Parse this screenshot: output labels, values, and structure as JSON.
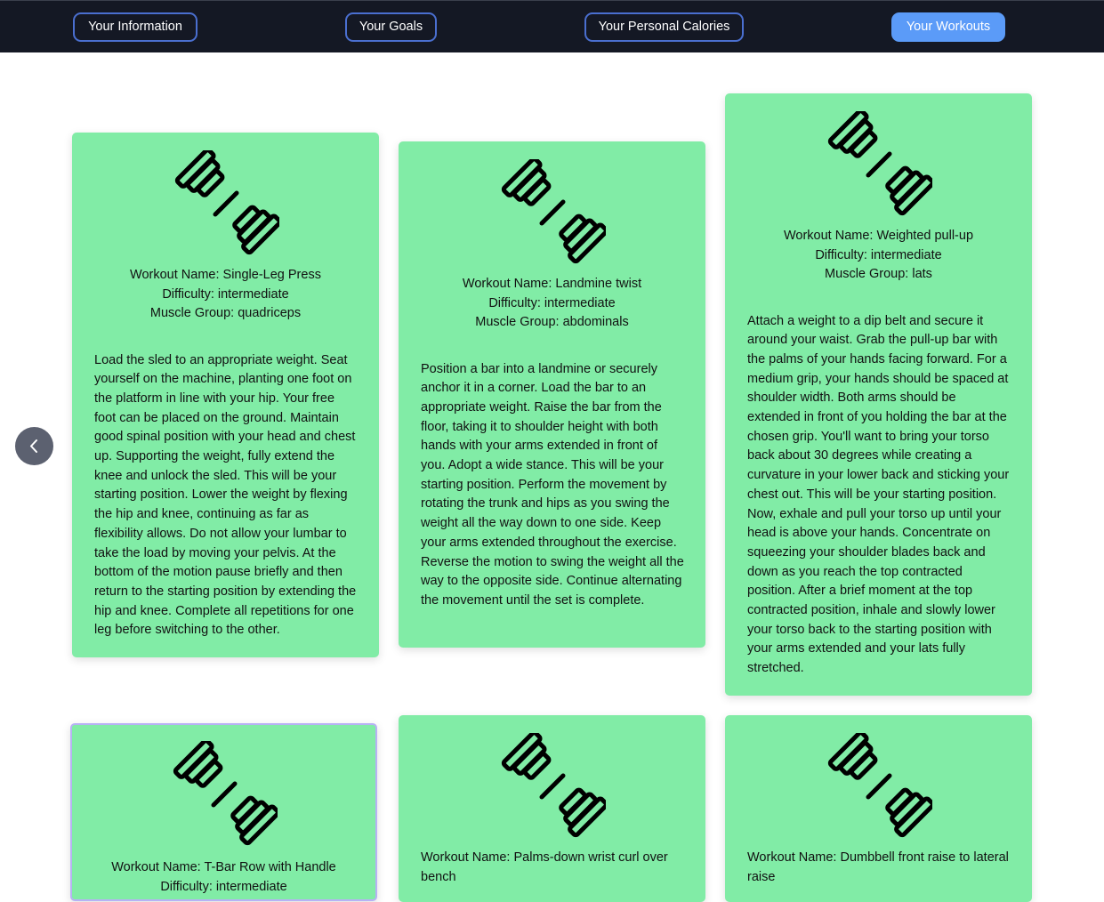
{
  "nav": {
    "your_information": "Your Information",
    "your_goals": "Your Goals",
    "your_personal_calories": "Your Personal Calories",
    "your_workouts": "Your Workouts"
  },
  "carousel": {
    "prev_icon": "chevron-left-icon"
  },
  "workouts": [
    {
      "name_line": "Workout Name: Single-Leg Press",
      "difficulty_line": "Difficulty: intermediate",
      "muscle_line": "Muscle Group: quadriceps",
      "instructions": "Load the sled to an appropriate weight. Seat yourself on the machine, planting one foot on the platform in line with your hip. Your free foot can be placed on the ground. Maintain good spinal position with your head and chest up. Supporting the weight, fully extend the knee and unlock the sled. This will be your starting position. Lower the weight by flexing the hip and knee, continuing as far as flexibility allows. Do not allow your lumbar to take the load by moving your pelvis. At the bottom of the motion pause briefly and then return to the starting position by extending the hip and knee. Complete all repetitions for one leg before switching to the other."
    },
    {
      "name_line": "Workout Name: Landmine twist",
      "difficulty_line": "Difficulty: intermediate",
      "muscle_line": "Muscle Group: abdominals",
      "instructions": "Position a bar into a landmine or securely anchor it in a corner. Load the bar to an appropriate weight. Raise the bar from the floor, taking it to shoulder height with both hands with your arms extended in front of you. Adopt a wide stance. This will be your starting position. Perform the movement by rotating the trunk and hips as you swing the weight all the way down to one side. Keep your arms extended throughout the exercise. Reverse the motion to swing the weight all the way to the opposite side. Continue alternating the movement until the set is complete."
    },
    {
      "name_line": "Workout Name: Weighted pull-up",
      "difficulty_line": "Difficulty: intermediate",
      "muscle_line": "Muscle Group: lats",
      "instructions": "Attach a weight to a dip belt and secure it around your waist. Grab the pull-up bar with the palms of your hands facing forward. For a medium grip, your hands should be spaced at shoulder width. Both arms should be extended in front of you holding the bar at the chosen grip. You'll want to bring your torso back about 30 degrees while creating a curvature in your lower back and sticking your chest out. This will be your starting position. Now, exhale and pull your torso up until your head is above your hands. Concentrate on squeezing your shoulder blades back and down as you reach the top contracted position. After a brief moment at the top contracted position, inhale and slowly lower your torso back to the starting position with your arms extended and your lats fully stretched."
    },
    {
      "name_line": "Workout Name: T-Bar Row with Handle",
      "difficulty_line": "Difficulty: intermediate"
    },
    {
      "name_line": "Workout Name: Palms-down wrist curl over bench"
    },
    {
      "name_line": "Workout Name: Dumbbell front raise to lateral raise"
    }
  ],
  "colors": {
    "nav_bg": "#141824",
    "nav_border": "#4a6fd0",
    "nav_active": "#5b9bf8",
    "card_bg": "#81eca6",
    "selected_border": "#b7b2f4"
  },
  "icons": {
    "workout_icon": "dumbbell-icon"
  }
}
